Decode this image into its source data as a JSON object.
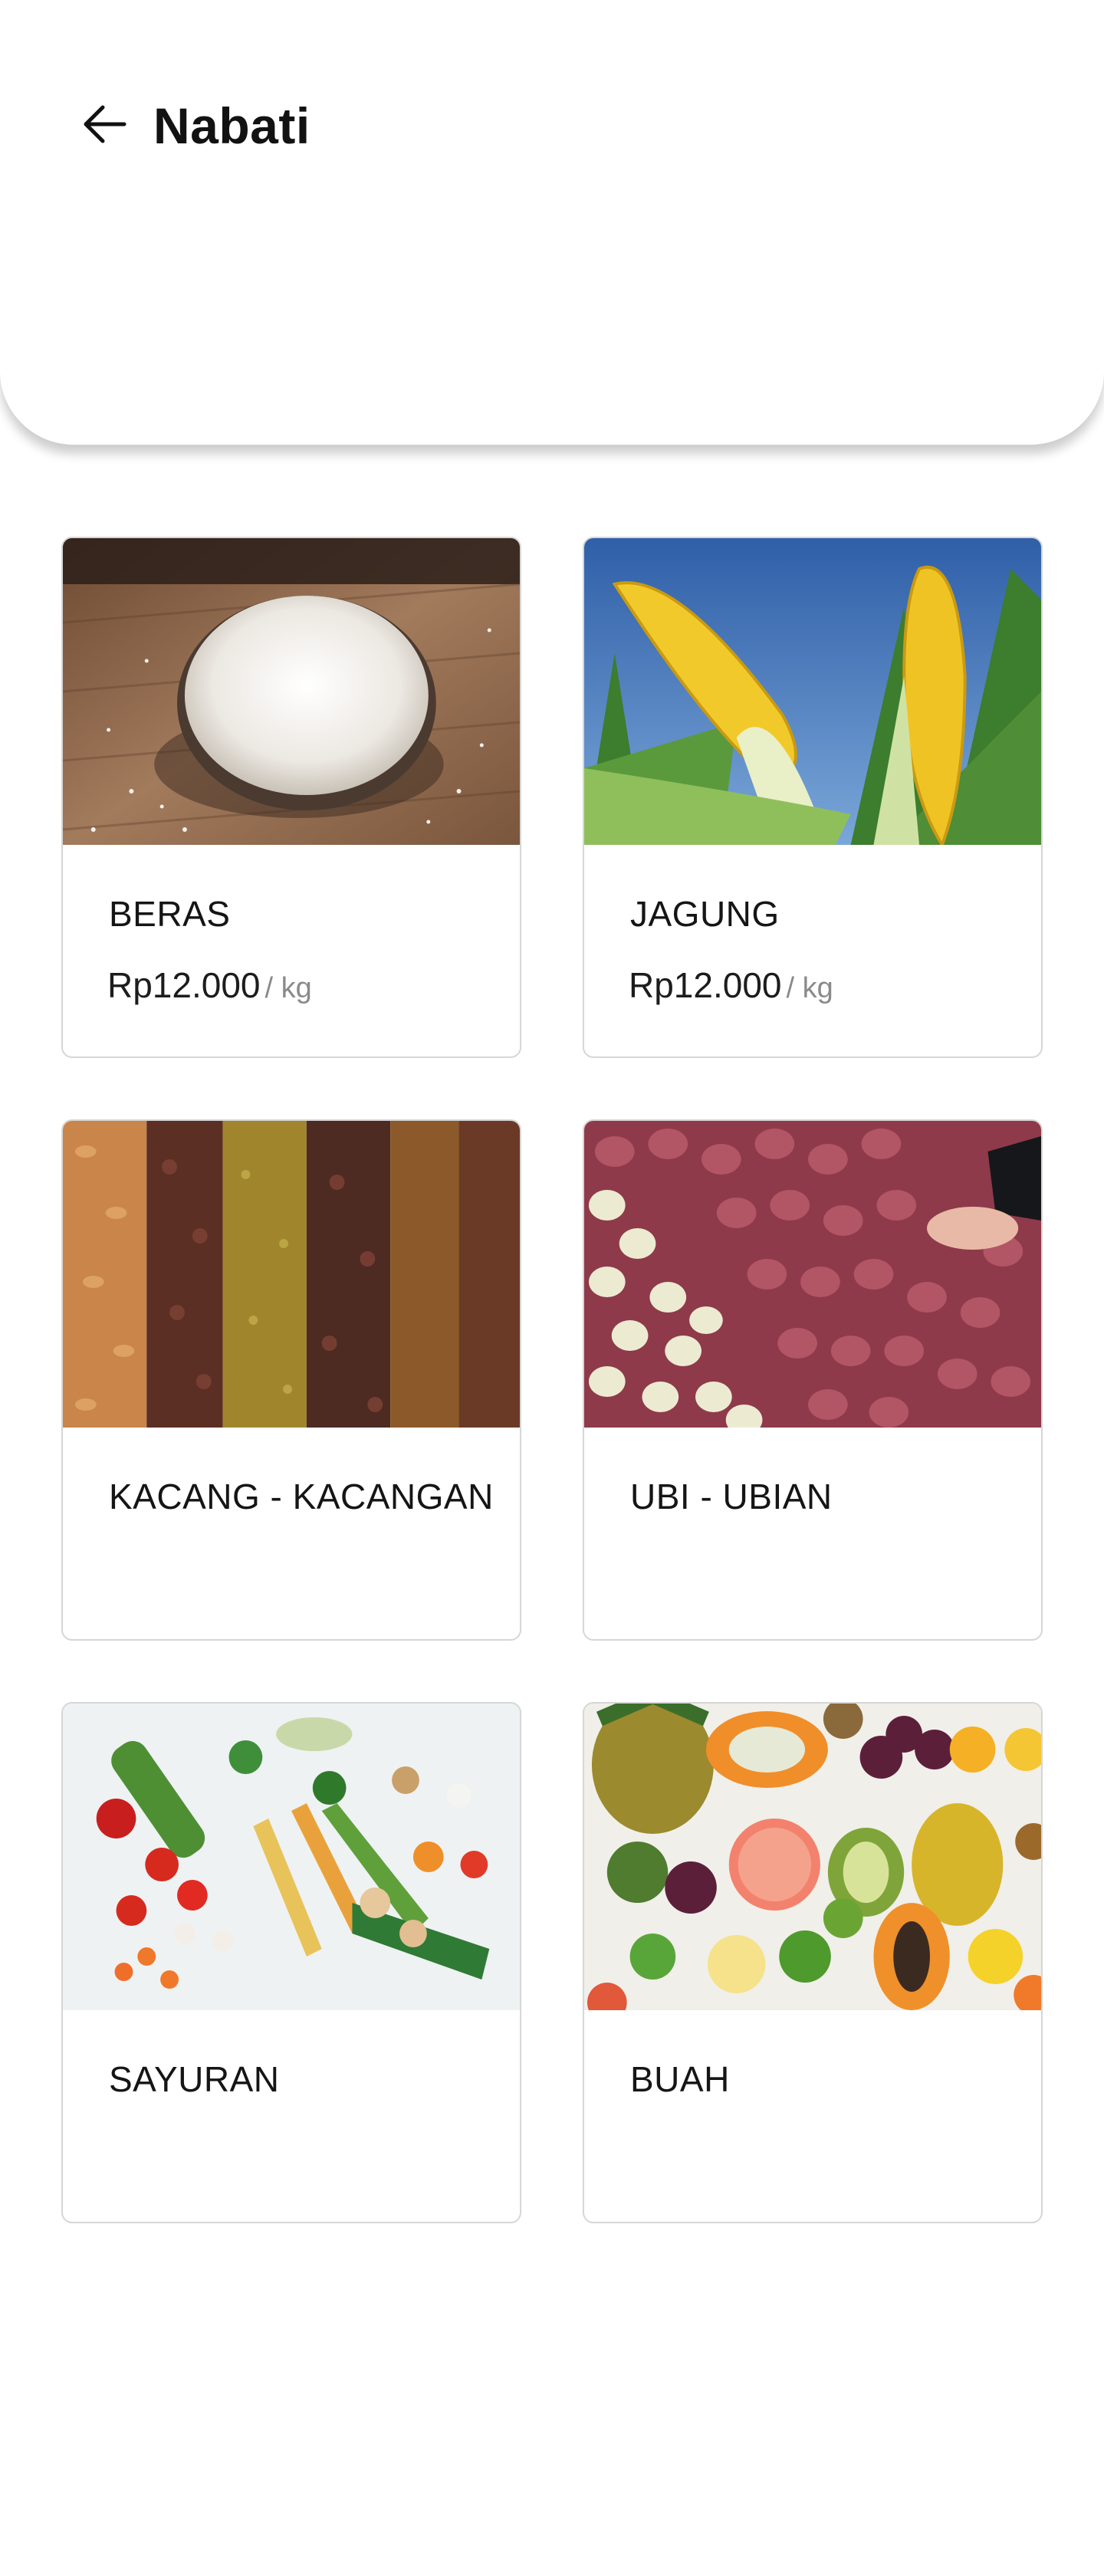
{
  "header": {
    "title": "Nabati",
    "back_icon": "arrow-left-icon"
  },
  "products": [
    {
      "name": "BERAS",
      "price": "Rp12.000",
      "unit": "/ kg",
      "image": "rice-bowl-photo"
    },
    {
      "name": "JAGUNG",
      "price": "Rp12.000",
      "unit": "/ kg",
      "image": "corn-cob-photo"
    },
    {
      "name": "KACANG - KACANGAN",
      "image": "nuts-legumes-photo"
    },
    {
      "name": "UBI - UBIAN",
      "image": "potatoes-tubers-photo"
    },
    {
      "name": "SAYURAN",
      "image": "vegetables-photo"
    },
    {
      "name": "BUAH",
      "image": "fruits-photo"
    }
  ]
}
